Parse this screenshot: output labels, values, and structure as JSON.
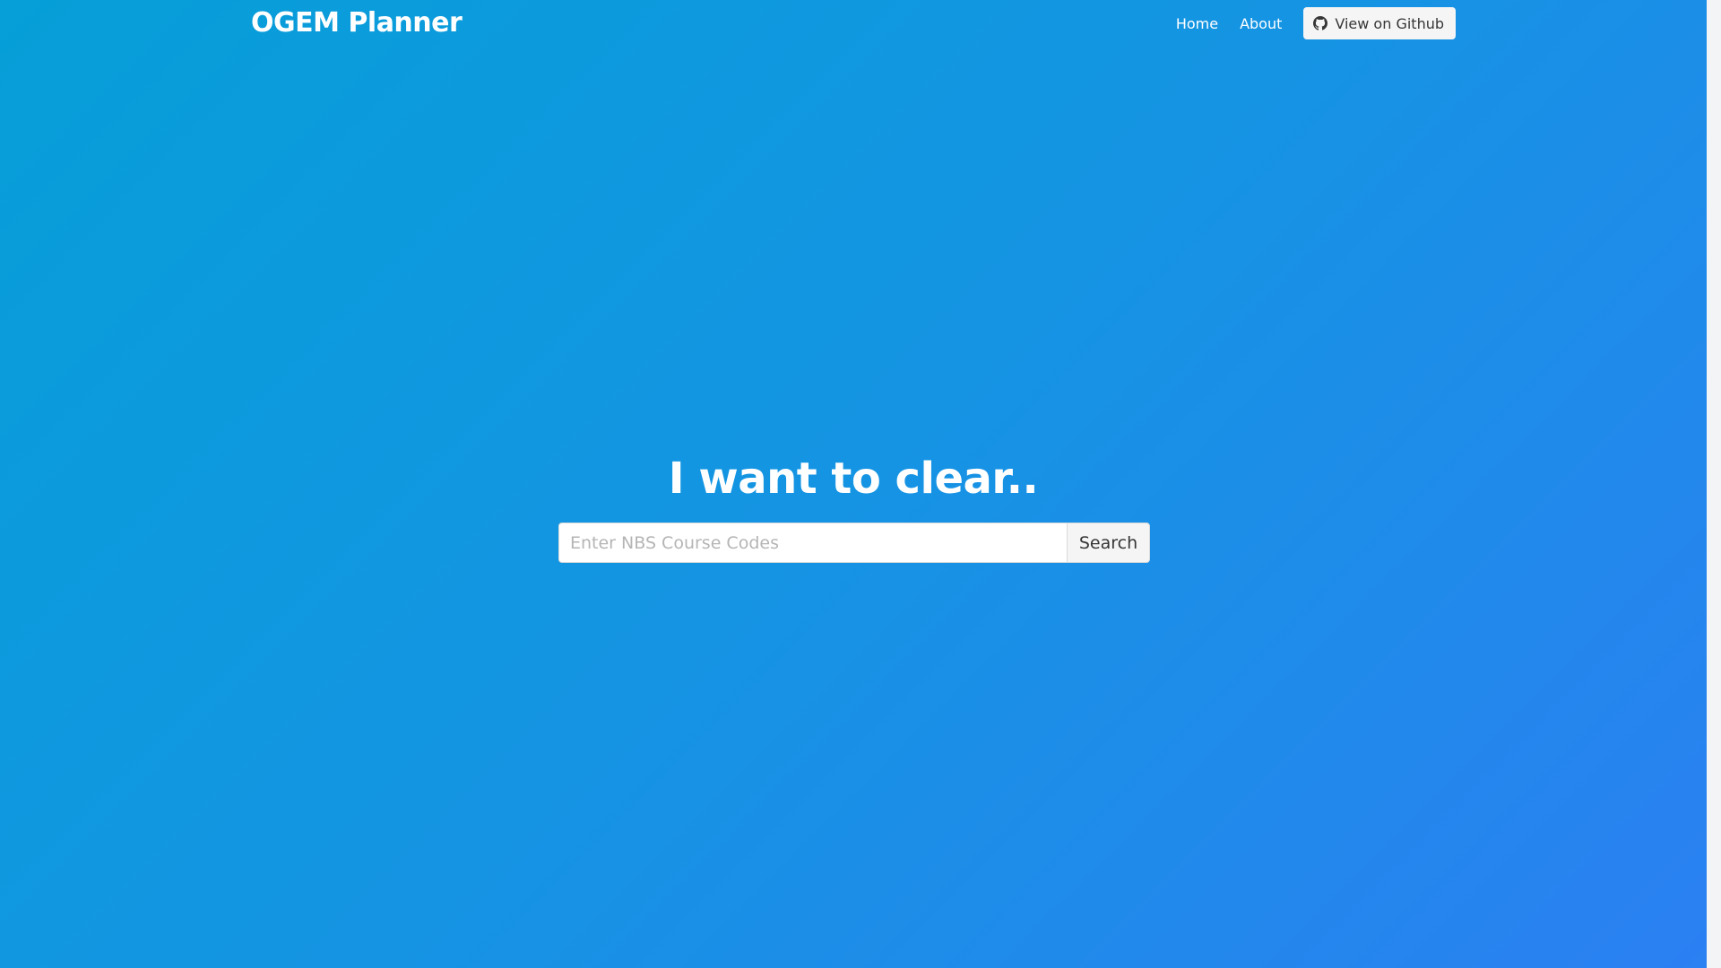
{
  "navbar": {
    "brand": "OGEM Planner",
    "links": [
      {
        "label": "Home"
      },
      {
        "label": "About"
      }
    ],
    "github_button": {
      "label": "View on Github",
      "icon": "github-icon"
    }
  },
  "hero": {
    "title": "I want to clear..",
    "search": {
      "placeholder": "Enter NBS Course Codes",
      "value": "",
      "button_label": "Search"
    }
  },
  "colors": {
    "background_gradient_start": "#069fd8",
    "background_gradient_end": "#2b80f2",
    "button_background": "#f5f5f5",
    "text_on_background": "#ffffff"
  }
}
